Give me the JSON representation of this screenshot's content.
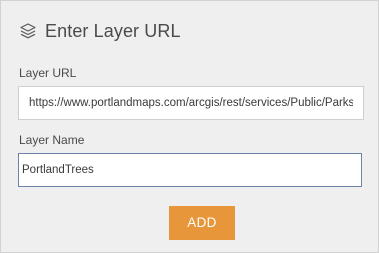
{
  "header": {
    "icon": "layers-icon",
    "title": "Enter Layer URL"
  },
  "layer_url": {
    "label": "Layer URL",
    "value": "https://www.portlandmaps.com/arcgis/rest/services/Public/Parks_Trees/MapServer"
  },
  "layer_name": {
    "label": "Layer Name",
    "value": "PortlandTrees"
  },
  "actions": {
    "add_label": "ADD"
  },
  "colors": {
    "panel_background": "#efefef",
    "accent_button": "#e8963a",
    "focus_border": "#6b84a8"
  }
}
